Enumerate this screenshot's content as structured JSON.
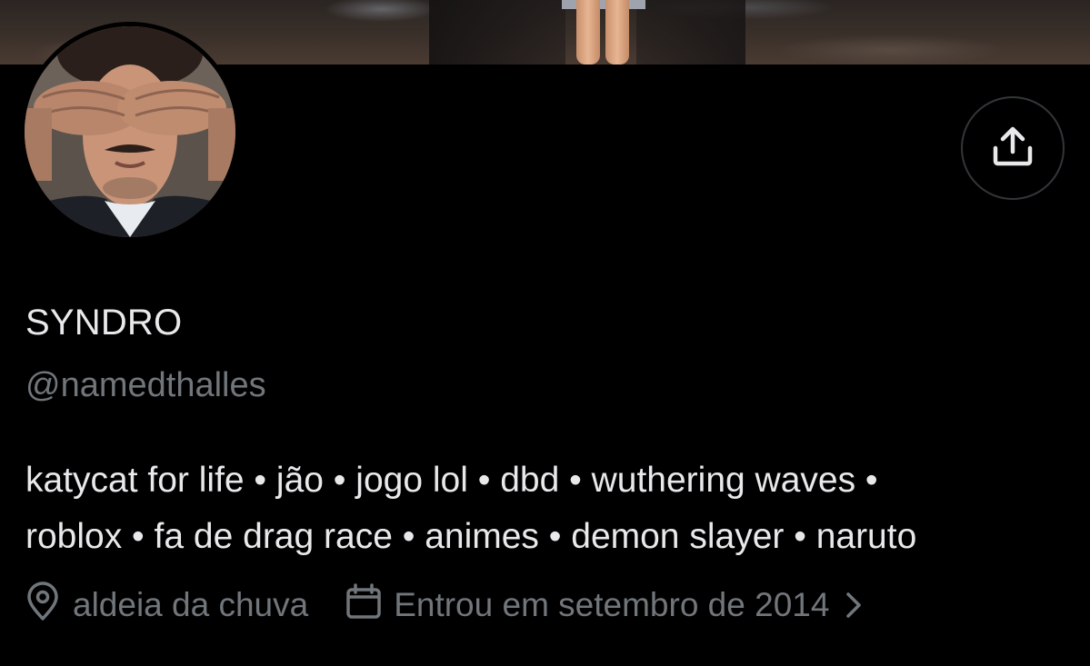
{
  "profile": {
    "display_name": "SYNDRO",
    "handle": "@namedthalles",
    "bio_line1": "katycat for life • jão • jogo lol • dbd • wuthering waves •",
    "bio_line2": "roblox • fa de drag race • animes • demon slayer • naruto",
    "location": "aldeia da chuva",
    "joined": "Entrou em setembro de 2014"
  },
  "icons": {
    "share": "share-upload-icon",
    "location": "location-pin-icon",
    "calendar": "calendar-icon",
    "chevron": "chevron-right-icon"
  },
  "colors": {
    "background": "#000000",
    "primary_text": "#e7e9ea",
    "secondary_text": "#71767b",
    "border": "#333639"
  }
}
